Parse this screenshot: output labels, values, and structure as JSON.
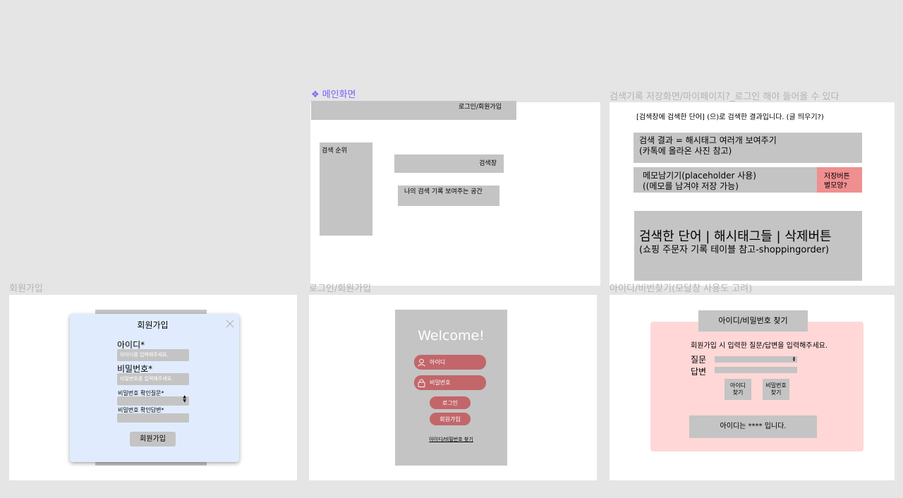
{
  "main_screen": {
    "label": "메인화면",
    "login_signup": "로그인/회원가입",
    "search_rank": "검색 순위",
    "search_box": "검색창",
    "my_history": "나의 검색 기록 보여주는 공간"
  },
  "history_screen": {
    "label": "검색기록 저장화면/마이페이지?_로그인 해야 들어올 수 있다",
    "header_text": "[검색창에 검색한 단어] (으)로 검색한 결과입니다. (글 띄우기?)",
    "result_line1": "검색 결과 = 해시태그 여러개 보여주기",
    "result_line2": "(카톡에 올라온 사진 참고)",
    "memo_line1": "메모남기기(placeholder 사용)",
    "memo_line2": "((메모를 남겨야 저장 가능)",
    "save_line1": "저장버튼",
    "save_line2": "별모양?",
    "table_line1": "검색한 단어 | 해시태그들 | 삭제버튼",
    "table_line2": "(쇼핑 주문자 기록 테이블 참고-shoppingorder)"
  },
  "signup_screen": {
    "label": "회원가입",
    "title": "회원가입",
    "id_label": "아이디*",
    "id_placeholder": "아이디를 입력해주세요.",
    "pw_label": "비밀번호*",
    "pw_placeholder": "비밀번호를 입력해주세요.",
    "question_label": "비밀번호 확인질문*",
    "answer_label": "비밀번호 확인답변*",
    "submit": "회원가입"
  },
  "login_screen": {
    "label": "로그인/회원가입",
    "welcome": "Welcome!",
    "id_field": "아이디",
    "pw_field": "비밀번호",
    "login_button": "로그인",
    "signup_button": "회원가입",
    "find_link": "아이디/비밀번호 찾기"
  },
  "find_screen": {
    "label": "아이디/비번찾기(모달창 사용도 고려)",
    "title": "아이디/비밀번호 찾기",
    "instruction": "회원가입 시 입력한 질문/답변을 입력해주세요.",
    "question_label": "질문",
    "answer_label": "답변",
    "find_id_line1": "아이디",
    "find_id_line2": "찾기",
    "find_pw_line1": "비밀번호",
    "find_pw_line2": "찾기",
    "result": "아이디는 **** 입니다."
  },
  "colors": {
    "canvas": "#e5e5e5",
    "frame": "#ffffff",
    "placeholder_gray": "#c4c4c4",
    "accent_purple": "#7b61ff",
    "save_red": "#f08f8f",
    "pill_red": "#c2666a",
    "modal_blue": "#e0ecfd",
    "find_pink": "#ffd7d7"
  }
}
